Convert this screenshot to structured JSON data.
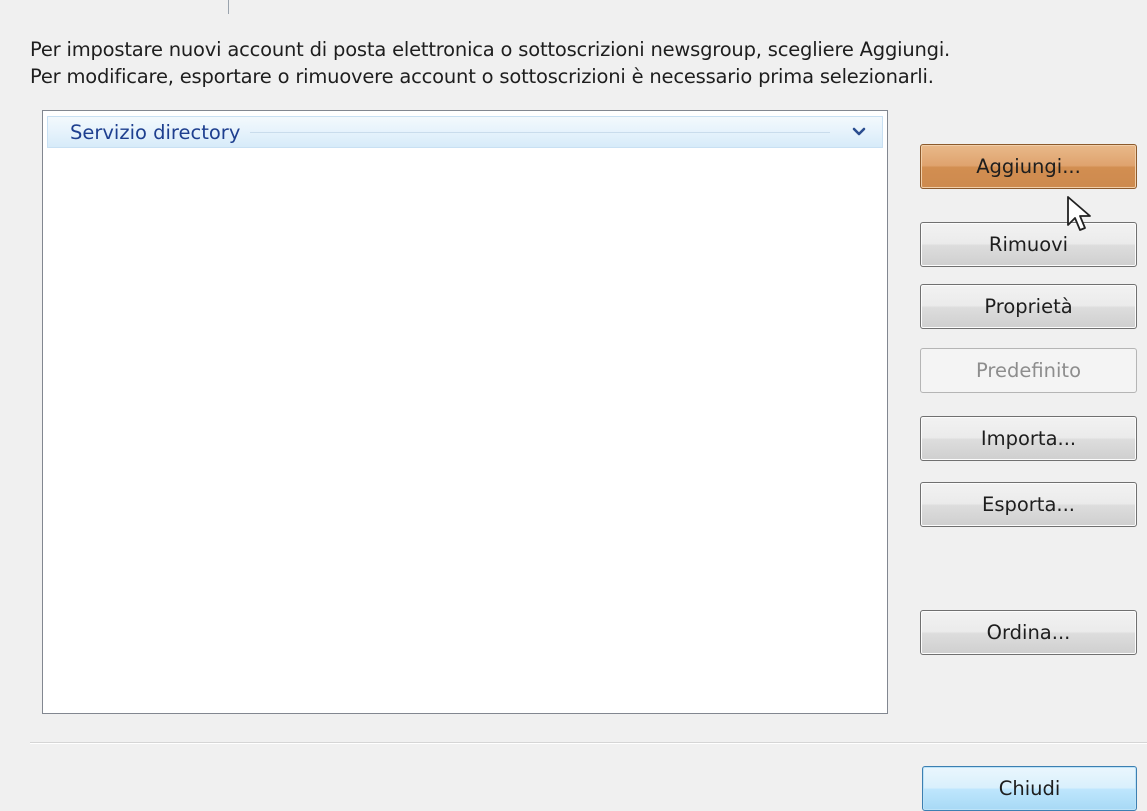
{
  "instructions": {
    "line1": "Per impostare nuovi account di posta elettronica o sottoscrizioni newsgroup, scegliere Aggiungi.",
    "line2": "Per modificare, esportare o rimuovere account o sottoscrizioni è necessario prima selezionarli."
  },
  "account_list": {
    "group_header": "Servizio directory",
    "group_icon": "chevron-down-icon"
  },
  "buttons": {
    "add": "Aggiungi...",
    "remove": "Rimuovi",
    "properties": "Proprietà",
    "set_default": "Predefinito",
    "import": "Importa...",
    "export": "Esporta...",
    "order": "Ordina...",
    "close": "Chiudi"
  },
  "states": {
    "add_button": "hover",
    "set_default_button": "disabled",
    "close_button": "focused"
  },
  "colors": {
    "hover_button": "#dfa36e",
    "group_header_text": "#1e3f8f",
    "window_background": "#f0f0f0"
  }
}
